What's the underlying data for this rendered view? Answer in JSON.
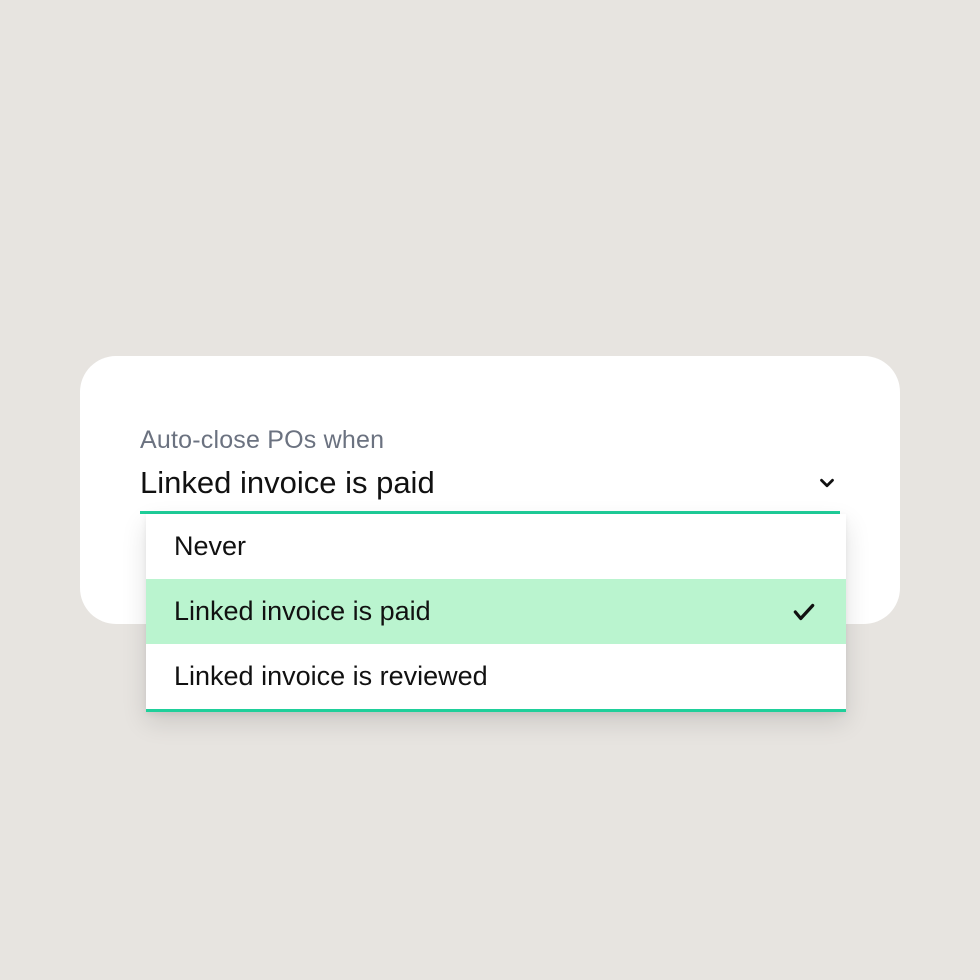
{
  "field": {
    "label": "Auto-close POs when",
    "selected": "Linked invoice is paid",
    "options": [
      {
        "label": "Never",
        "selected": false
      },
      {
        "label": "Linked invoice is paid",
        "selected": true
      },
      {
        "label": "Linked invoice is reviewed",
        "selected": false
      }
    ]
  }
}
